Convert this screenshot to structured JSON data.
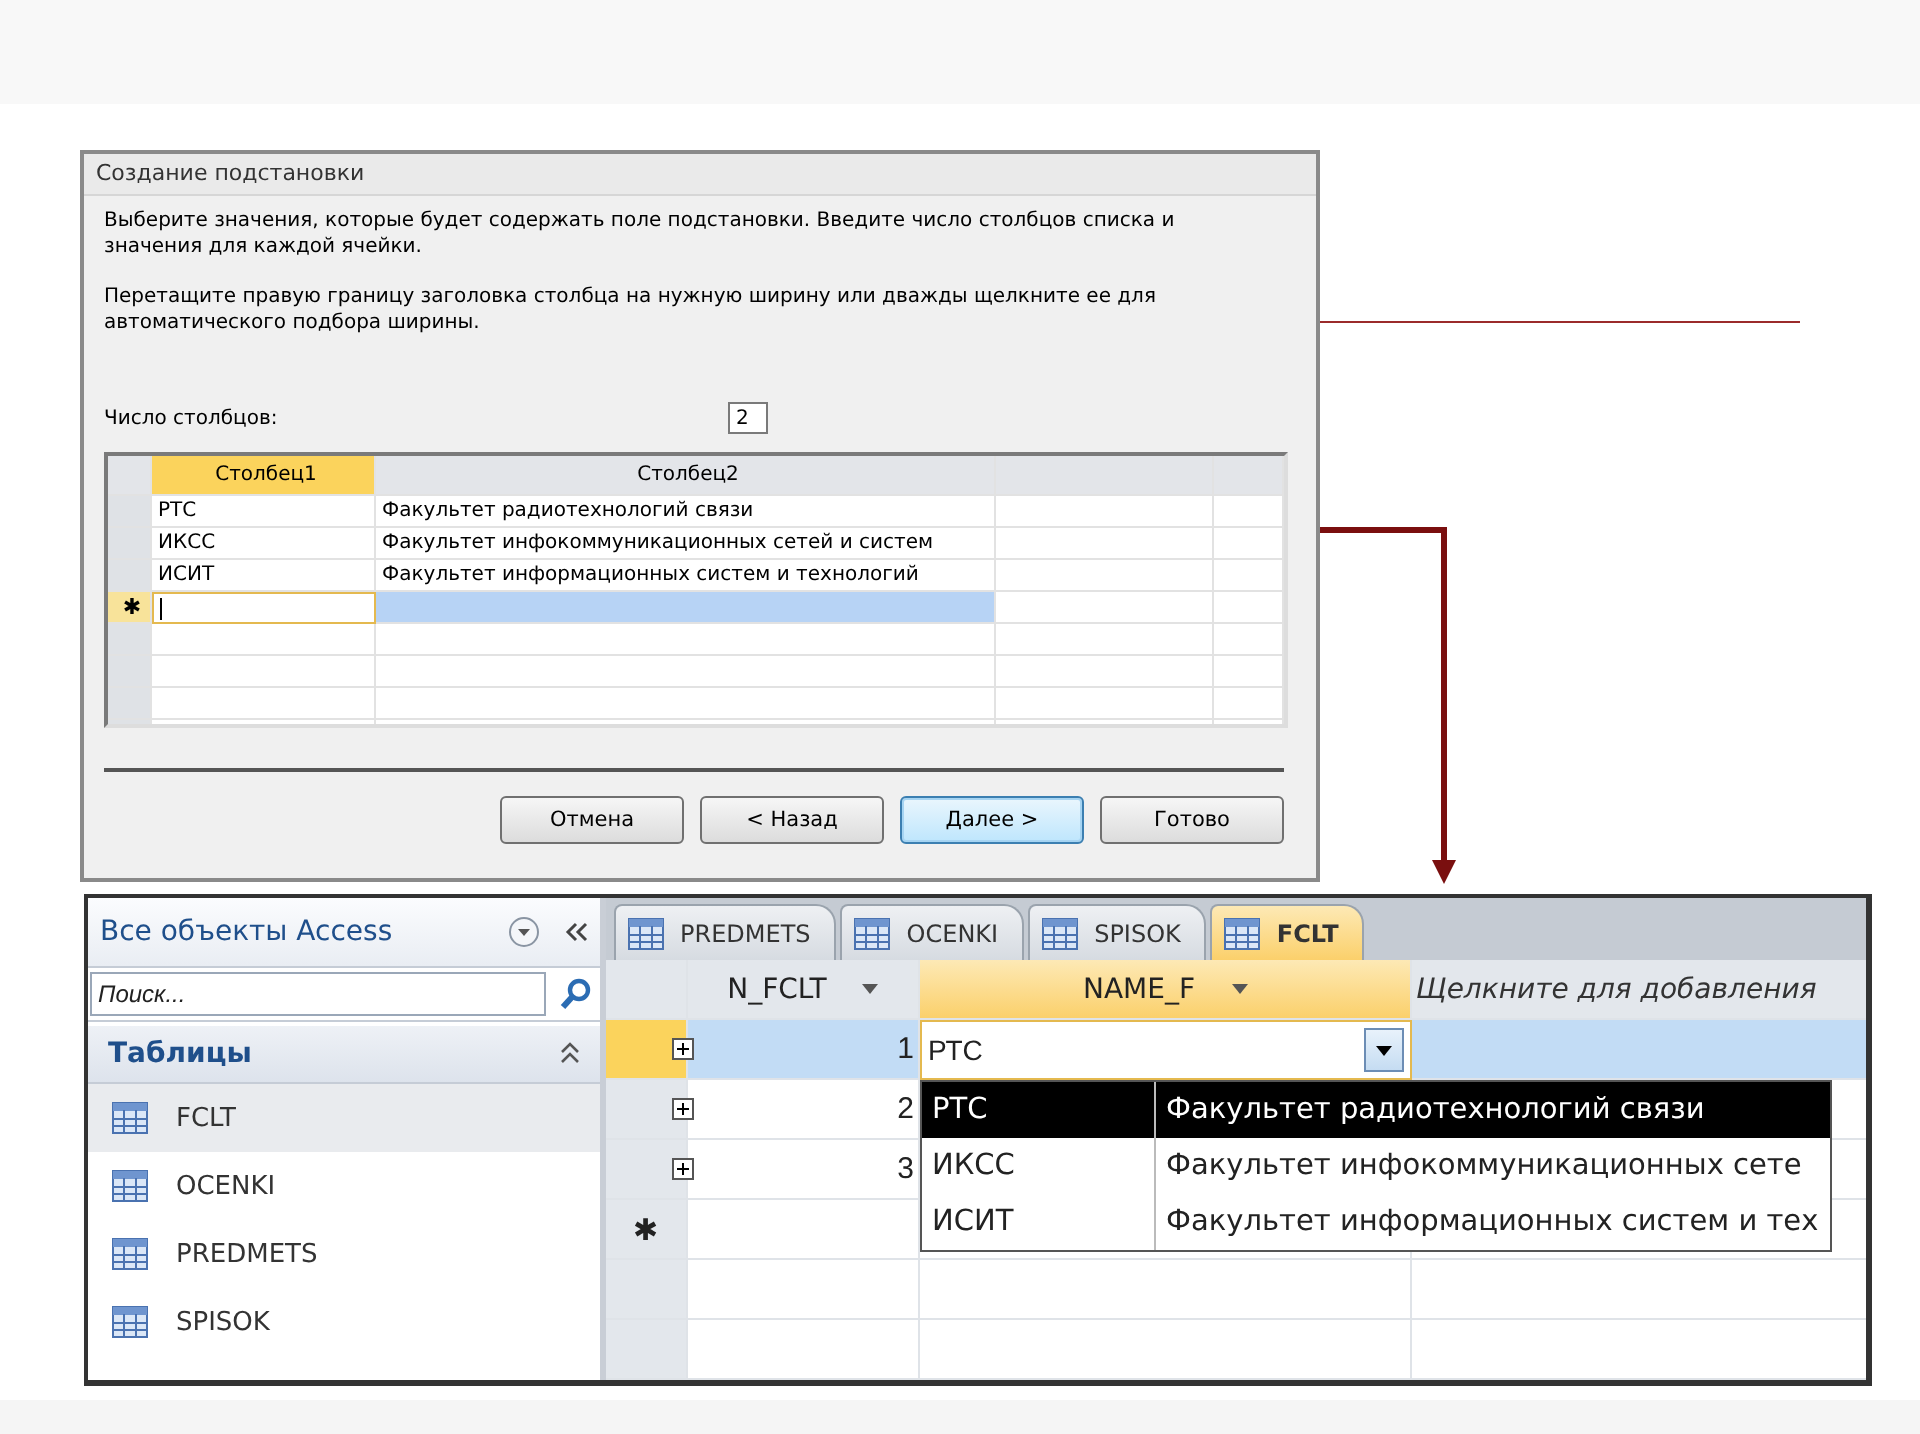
{
  "dialog": {
    "title": "Создание подстановки",
    "instructions": [
      "Выберите значения, которые будет содержать поле подстановки. Введите число столбцов списка и значения для каждой ячейки.",
      "Перетащите правую границу заголовка столбца на нужную ширину или дважды щелкните ее для автоматического подбора ширины."
    ],
    "column_count_label": "Число столбцов:",
    "column_count": "2",
    "grid": {
      "columns": [
        {
          "label": "Столбец1",
          "selected": true
        },
        {
          "label": "Столбец2",
          "selected": false
        }
      ],
      "rows": [
        [
          "РТС",
          "Факультет радиотехнологий связи"
        ],
        [
          "ИКСС",
          "Факультет инфокоммуникационных сетей и систем"
        ],
        [
          "ИСИТ",
          "Факультет информационных систем и технологий"
        ]
      ],
      "new_row_marker": "✱"
    },
    "buttons": [
      {
        "label": "Отмена",
        "default": false
      },
      {
        "label": "< Назад",
        "default": false
      },
      {
        "label": "Далее >",
        "default": true
      },
      {
        "label": "Готово",
        "default": false
      }
    ]
  },
  "access": {
    "nav": {
      "title": "Все объекты Access",
      "search_placeholder": "Поиск...",
      "group": "Таблицы",
      "items": [
        {
          "label": "FCLT",
          "selected": true
        },
        {
          "label": "OCENKI",
          "selected": false
        },
        {
          "label": "PREDMETS",
          "selected": false
        },
        {
          "label": "SPISOK",
          "selected": false
        }
      ]
    },
    "tabs": [
      {
        "label": "PREDMETS",
        "selected": false
      },
      {
        "label": "OCENKI",
        "selected": false
      },
      {
        "label": "SPISOK",
        "selected": false
      },
      {
        "label": "FCLT",
        "selected": true
      }
    ],
    "datasheet": {
      "columns": [
        {
          "label": "N_FCLT",
          "kind": "field",
          "selected": false
        },
        {
          "label": "NAME_F",
          "kind": "field",
          "selected": true
        },
        {
          "label": "Щелкните для добавления",
          "kind": "add",
          "selected": false
        }
      ],
      "rows": [
        {
          "id": "1",
          "value": "РТС",
          "selected": true
        },
        {
          "id": "2",
          "selected": false
        },
        {
          "id": "3",
          "selected": false
        }
      ],
      "new_row_marker": "✱"
    },
    "dropdown": {
      "rows": [
        {
          "code": "РТС",
          "name": "Факультет радиотехнологий связи",
          "selected": true
        },
        {
          "code": "ИКСС",
          "name": "Факультет инфокоммуникационных сете",
          "selected": false
        },
        {
          "code": "ИСИТ",
          "name": "Факультет информационных систем и тех",
          "selected": false
        }
      ]
    }
  }
}
